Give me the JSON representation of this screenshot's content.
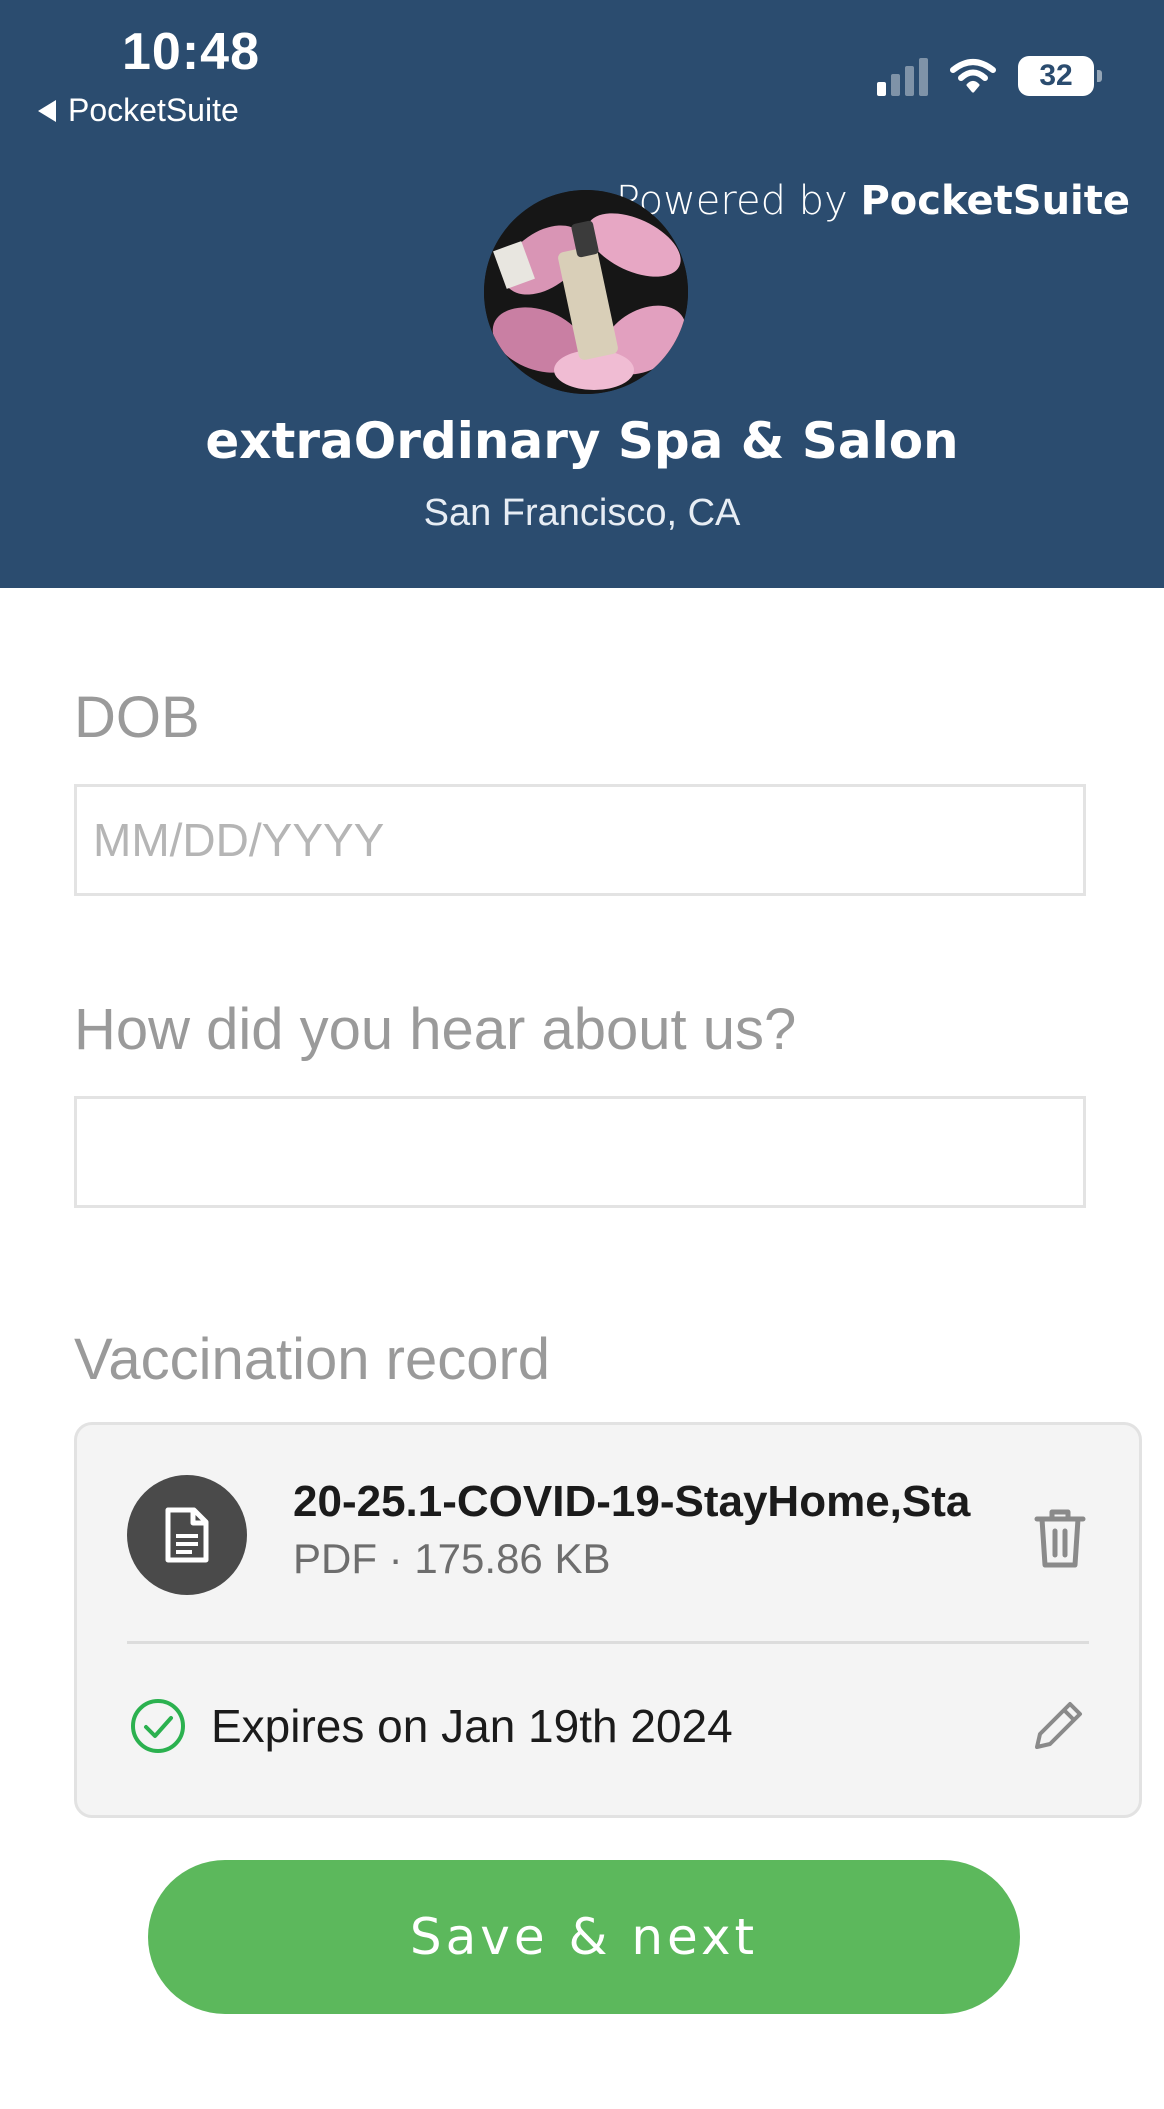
{
  "status_bar": {
    "time": "10:48",
    "back_label": "PocketSuite",
    "battery": "32"
  },
  "header": {
    "powered_prefix": "Powered by ",
    "powered_brand": "PocketSuite",
    "business_name": "extraOrdinary Spa & Salon",
    "location": "San Francisco, CA",
    "background_color": "#2b4c6f"
  },
  "form": {
    "dob": {
      "label": "DOB",
      "placeholder": "MM/DD/YYYY",
      "value": ""
    },
    "referral": {
      "label": "How did you hear about us?",
      "placeholder": "",
      "value": ""
    },
    "vaccination": {
      "label": "Vaccination record",
      "file_name": "20-25.1-COVID-19-StayHome,Sta",
      "file_meta": "PDF · 175.86 KB",
      "expires_text": "Expires on Jan 19th 2024",
      "file_icon": "document-icon",
      "delete_icon": "trash-icon",
      "status_icon": "check-circle-icon",
      "edit_icon": "pencil-icon"
    }
  },
  "actions": {
    "save_label": "Save & next",
    "save_color": "#5cb85c"
  }
}
